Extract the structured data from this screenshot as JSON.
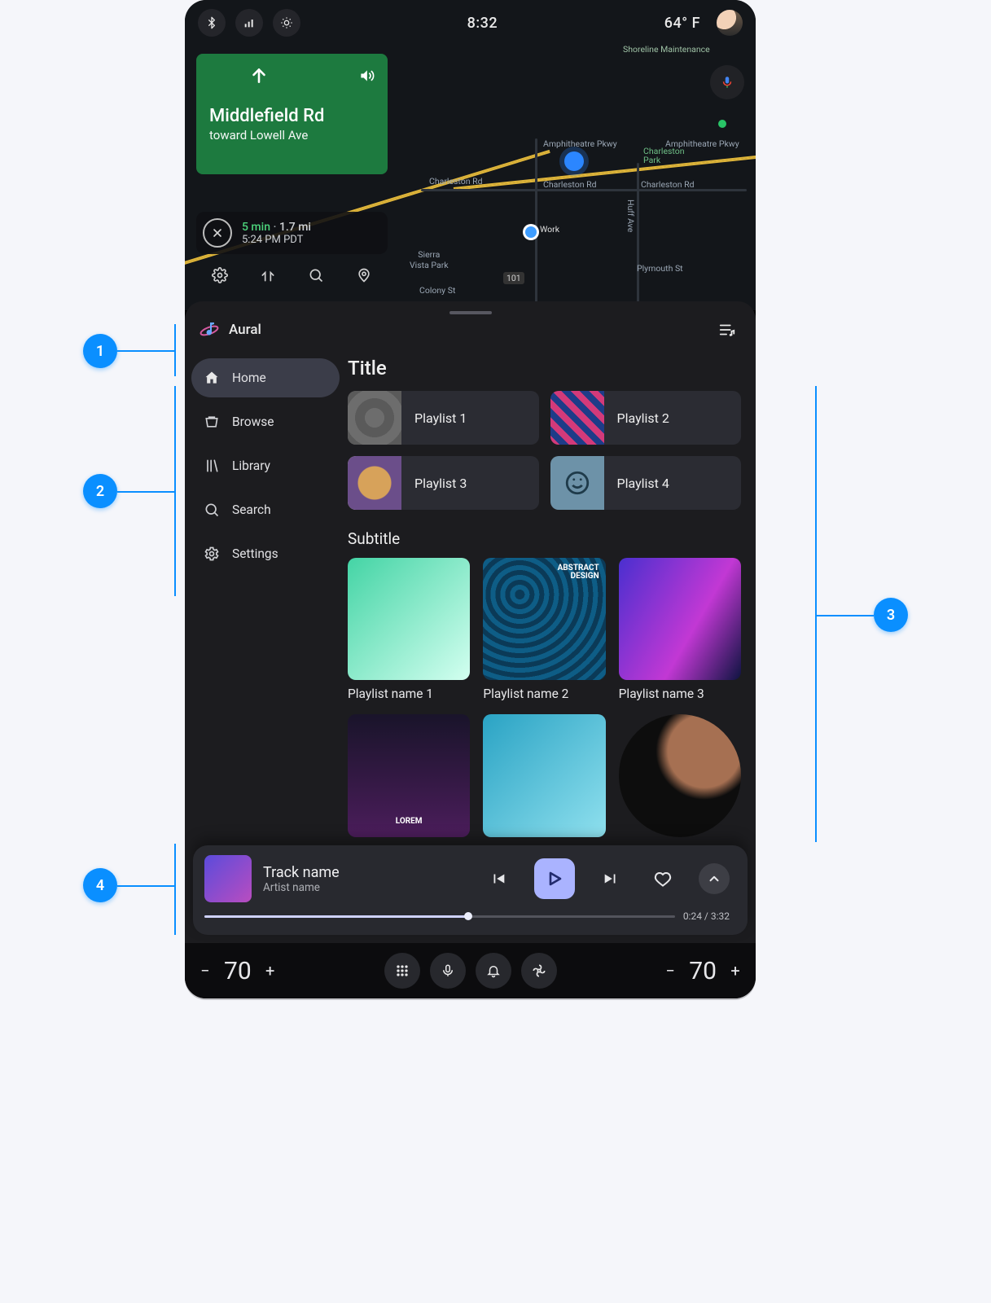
{
  "status": {
    "time": "8:32",
    "temperature": "64° F"
  },
  "nav_card": {
    "arrow_label": "Go straight",
    "street": "Middlefield Rd",
    "toward": "toward Lowell Ave"
  },
  "eta": {
    "duration": "5 min",
    "distance": "1.7 mi",
    "arrival": "5:24 PM PDT"
  },
  "map": {
    "streets": {
      "amphitheatre_1": "Amphitheatre Pkwy",
      "amphitheatre_2": "Amphitheatre Pkwy",
      "charleston_1": "Charleston Rd",
      "charleston_2": "Charleston Rd",
      "charleston_3": "Charleston Rd",
      "huff": "Huff Ave",
      "plymouth": "Plymouth St",
      "colony": "Colony St",
      "shoreline_maint": "Shoreline Maintenance",
      "sierra_vista": "Sierra\nVista Park",
      "charleston_park": "Charleston\nPark"
    },
    "pois": {
      "work": "Work"
    },
    "shield": "101"
  },
  "app": {
    "name": "Aural"
  },
  "rail": [
    {
      "id": "home",
      "label": "Home",
      "active": true
    },
    {
      "id": "browse",
      "label": "Browse",
      "active": false
    },
    {
      "id": "library",
      "label": "Library",
      "active": false
    },
    {
      "id": "search",
      "label": "Search",
      "active": false
    },
    {
      "id": "settings",
      "label": "Settings",
      "active": false
    }
  ],
  "content": {
    "section1_title": "Title",
    "playlists_row1": [
      {
        "label": "Playlist 1"
      },
      {
        "label": "Playlist 2"
      },
      {
        "label": "Playlist 3"
      },
      {
        "label": "Playlist 4"
      }
    ],
    "section2_title": "Subtitle",
    "tiles_row1": [
      {
        "label": "Playlist name 1",
        "overlay": ""
      },
      {
        "label": "Playlist name 2",
        "overlay": "ABSTRACT\nDESIGN"
      },
      {
        "label": "Playlist name 3",
        "overlay": ""
      }
    ],
    "tiles_row2_overlay2": "LOREM"
  },
  "now_playing": {
    "track": "Track name",
    "artist": "Artist name",
    "elapsed": "0:24",
    "total": "3:32",
    "progress_pct": 56
  },
  "sysbar": {
    "left_temp": "70",
    "right_temp": "70"
  },
  "annotations": {
    "m1": "1",
    "m2": "2",
    "m3": "3",
    "m4": "4"
  }
}
